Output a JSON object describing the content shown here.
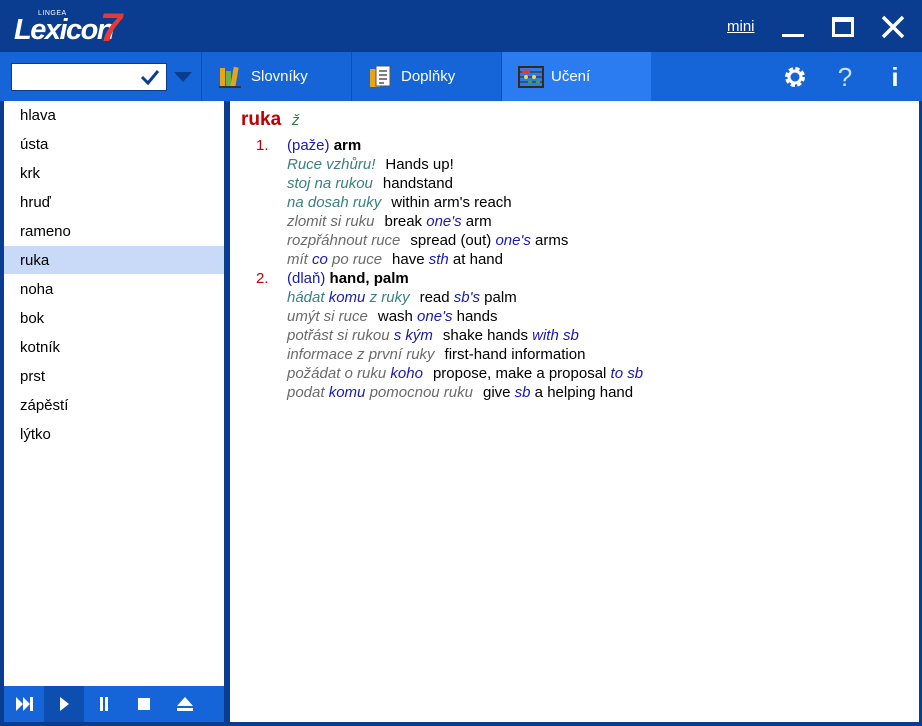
{
  "app": {
    "brand_small": "LINGEA",
    "brand_name": "Lexicon",
    "brand_version": "7",
    "mini_label": "mini"
  },
  "search": {
    "value": "",
    "placeholder": ""
  },
  "tabs": [
    {
      "label": "Slovníky"
    },
    {
      "label": "Doplňky"
    },
    {
      "label": "Učení"
    }
  ],
  "word_list": [
    "hlava",
    "ústa",
    "krk",
    "hruď",
    "rameno",
    "ruka",
    "noha",
    "bok",
    "kotník",
    "prst",
    "zápěstí",
    "lýtko"
  ],
  "selected_word": "ruka",
  "entry": {
    "headword": "ruka",
    "gender": "ž",
    "senses": [
      {
        "num": "1.",
        "note": "(paže)",
        "translation": "arm",
        "examples": [
          {
            "cz": [
              {
                "t": "Ruce vzhůru!",
                "c": "teal"
              }
            ],
            "en": [
              {
                "t": "Hands up!",
                "c": "black"
              }
            ]
          },
          {
            "cz": [
              {
                "t": "stoj na rukou",
                "c": "teal"
              }
            ],
            "en": [
              {
                "t": "handstand",
                "c": "black"
              }
            ]
          },
          {
            "cz": [
              {
                "t": "na dosah ruky",
                "c": "teal"
              }
            ],
            "en": [
              {
                "t": "within arm's reach",
                "c": "black"
              }
            ]
          },
          {
            "cz": [
              {
                "t": "zlomit si ruku",
                "c": "gray"
              }
            ],
            "en": [
              {
                "t": "break ",
                "c": "black"
              },
              {
                "t": "one's",
                "c": "blue"
              },
              {
                "t": " arm",
                "c": "black"
              }
            ]
          },
          {
            "cz": [
              {
                "t": "rozpřáhnout ruce",
                "c": "gray"
              }
            ],
            "en": [
              {
                "t": "spread (out) ",
                "c": "black"
              },
              {
                "t": "one's",
                "c": "blue"
              },
              {
                "t": " arms",
                "c": "black"
              }
            ]
          },
          {
            "cz": [
              {
                "t": "mít ",
                "c": "gray"
              },
              {
                "t": "co",
                "c": "blue"
              },
              {
                "t": " po ruce",
                "c": "gray"
              }
            ],
            "en": [
              {
                "t": "have ",
                "c": "black"
              },
              {
                "t": "sth",
                "c": "blue"
              },
              {
                "t": " at hand",
                "c": "black"
              }
            ]
          }
        ]
      },
      {
        "num": "2.",
        "note": "(dlaň)",
        "translation": "hand, palm",
        "examples": [
          {
            "cz": [
              {
                "t": "hádat ",
                "c": "teal"
              },
              {
                "t": "komu",
                "c": "blue"
              },
              {
                "t": " z ruky",
                "c": "teal"
              }
            ],
            "en": [
              {
                "t": "read ",
                "c": "black"
              },
              {
                "t": "sb's",
                "c": "blue"
              },
              {
                "t": " palm",
                "c": "black"
              }
            ]
          },
          {
            "cz": [
              {
                "t": "umýt si ruce",
                "c": "gray"
              }
            ],
            "en": [
              {
                "t": "wash ",
                "c": "black"
              },
              {
                "t": "one's",
                "c": "blue"
              },
              {
                "t": " hands",
                "c": "black"
              }
            ]
          },
          {
            "cz": [
              {
                "t": "potřást si rukou ",
                "c": "gray"
              },
              {
                "t": "s kým",
                "c": "blue"
              }
            ],
            "en": [
              {
                "t": "shake hands ",
                "c": "black"
              },
              {
                "t": "with sb",
                "c": "blue"
              }
            ]
          },
          {
            "cz": [
              {
                "t": "informace z první ruky",
                "c": "gray"
              }
            ],
            "en": [
              {
                "t": "first-hand information",
                "c": "black"
              }
            ]
          },
          {
            "cz": [
              {
                "t": "požádat o ruku ",
                "c": "gray"
              },
              {
                "t": "koho",
                "c": "blue"
              }
            ],
            "en": [
              {
                "t": "propose, make a proposal ",
                "c": "black"
              },
              {
                "t": "to sb",
                "c": "blue"
              }
            ]
          },
          {
            "cz": [
              {
                "t": "podat ",
                "c": "gray"
              },
              {
                "t": "komu",
                "c": "blue"
              },
              {
                "t": " pomocnou ruku",
                "c": "gray"
              }
            ],
            "en": [
              {
                "t": "give ",
                "c": "black"
              },
              {
                "t": "sb",
                "c": "blue"
              },
              {
                "t": " a helping hand",
                "c": "black"
              }
            ]
          }
        ]
      }
    ]
  },
  "icons": {
    "confirm": "checkmark-icon",
    "dropdown": "chevron-down-icon",
    "tab_icons": [
      "books-icon",
      "document-icon",
      "abacus-icon"
    ],
    "toolbar": [
      "gear-icon",
      "help-icon",
      "info-icon"
    ],
    "player": [
      "skip-icon",
      "play-icon",
      "pause-icon",
      "stop-icon",
      "eject-icon"
    ]
  },
  "colors": {
    "title_bar": "#0a3d8f",
    "toolbar": "#1565d8",
    "active_tab": "#2a7cf0",
    "selected_item": "#c8daf8",
    "headword": "#c00000",
    "gender": "#2e7d32",
    "czech_phrase": "#3a8080",
    "variable": "#1a1ab0"
  }
}
